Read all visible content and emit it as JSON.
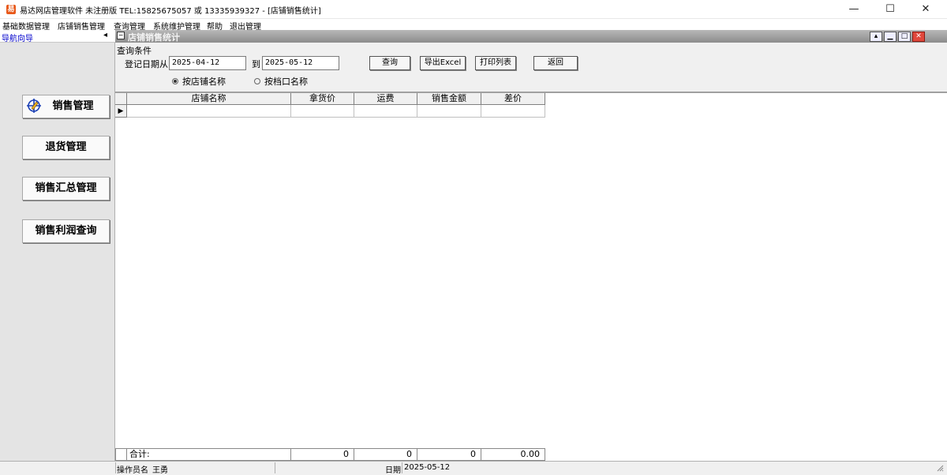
{
  "window": {
    "icon_text": "易",
    "title": "易达网店管理软件  未注册版 TEL:15825675057 或 13335939327  - [店铺销售统计]",
    "minimize": "—",
    "maximize": "☐",
    "close": "✕"
  },
  "menu": [
    "基础数据管理",
    "店铺销售管理",
    "查询管理",
    "系统维护管理",
    "帮助",
    "退出管理"
  ],
  "nav": {
    "header": "导航向导",
    "collapse": "◂",
    "items": [
      "销售管理",
      "退货管理",
      "销售汇总管理",
      "销售利润查询"
    ]
  },
  "child": {
    "sys_icon": "−",
    "title": "店铺销售统计",
    "btn_up": "▴",
    "btn_min": "▁",
    "btn_max": "□",
    "btn_close": "✕"
  },
  "query": {
    "group_label": "查询条件",
    "date_from_label": "登记日期从",
    "date_from": "2025-04-12",
    "date_to_label": "到",
    "date_to": "2025-05-12",
    "btn_query": "查询",
    "btn_export": "导出Excel",
    "btn_print": "打印列表",
    "btn_back": "返回",
    "radio_store": "按店铺名称",
    "radio_stall": "按档口名称",
    "selected": "store"
  },
  "grid": {
    "columns": [
      "店铺名称",
      "拿货价",
      "运费",
      "销售金额",
      "差价"
    ],
    "row_indicator": "▶"
  },
  "totals": {
    "label": "合计:",
    "values": [
      "0",
      "0",
      "0",
      "0.00"
    ]
  },
  "status": {
    "operator_label": "操作员名",
    "operator": "王勇",
    "date_label": "日期",
    "date": "2025-05-12"
  },
  "colors": {
    "nav_header_text": "#0000cc",
    "app_icon": "#e8591a",
    "child_close": "#e0483c"
  }
}
